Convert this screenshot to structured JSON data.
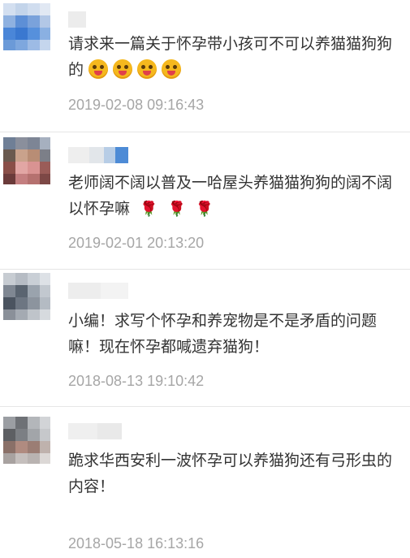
{
  "comments": [
    {
      "text": "请求来一篇关于怀孕带小孩可不可以养猫猫狗狗的",
      "emoji_icons": [
        "tongue-wink-emoji-icon",
        "tongue-wink-emoji-icon",
        "tongue-wink-emoji-icon",
        "tongue-wink-emoji-icon"
      ],
      "time": "2019-02-08 09:16:43"
    },
    {
      "text": "老师阔不阔以普及一哈屋头养猫猫狗狗的阔不阔以怀孕嘛",
      "emoji_icons": [
        "rose-icon",
        "rose-icon",
        "rose-icon"
      ],
      "emoji_glyph": "🌹",
      "time": "2019-02-01 20:13:20"
    },
    {
      "text": "小编！求写个怀孕和养宠物是不是矛盾的问题嘛！现在怀孕都喊遗弃猫狗！",
      "time": "2018-08-13 19:10:42"
    },
    {
      "text": "跪求华西安利一波怀孕可以养猫狗还有弓形虫的内容！",
      "time": "2018-05-18 16:13:16"
    }
  ],
  "colors": {
    "text": "#333333",
    "timestamp": "#a6a6a6",
    "divider": "#e6e6e6",
    "background": "#ffffff"
  }
}
